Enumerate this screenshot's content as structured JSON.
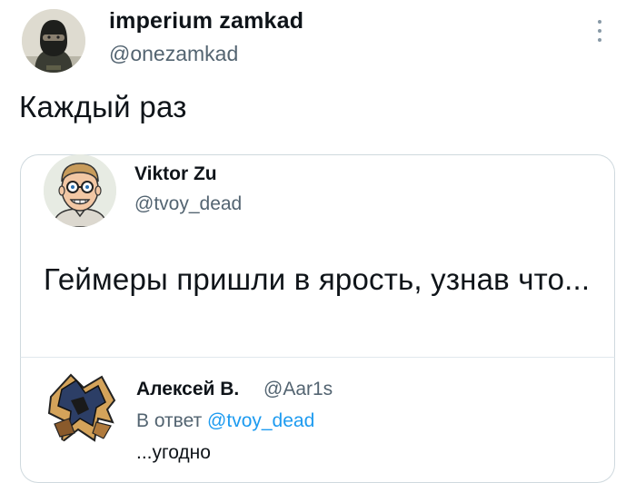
{
  "tweet": {
    "author_name": "imperium zamkad",
    "author_handle": "@onezamkad",
    "text": "Каждый раз",
    "more_icon": "more-vertical-icon"
  },
  "quoted_tweet": {
    "author_name": "Viktor Zu",
    "author_handle": "@tvoy_dead",
    "text": "Геймеры пришли в ярость, узнав что..."
  },
  "reply": {
    "author_name": "Алексей В.",
    "author_handle": "@Aar1s",
    "reply_prefix": "В ответ",
    "reply_to_handle": "@tvoy_dead",
    "text": "...угодно"
  },
  "colors": {
    "text": "#0f1419",
    "secondary": "#536471",
    "link": "#1d9bf0",
    "border": "#cfd9de"
  }
}
